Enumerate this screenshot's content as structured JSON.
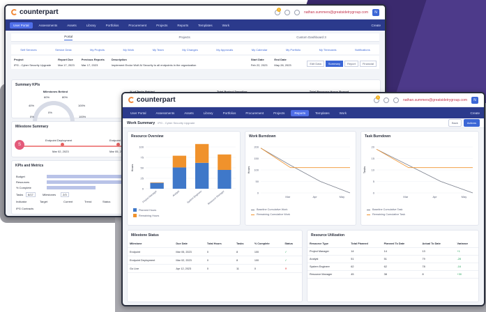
{
  "brand": "counterpart",
  "user_email": "nathan.summers@greatsidetrygroup.com",
  "avatar_initial": "N",
  "notif_count": "1",
  "nav": {
    "items": [
      "User Portal",
      "Assessments",
      "Assets",
      "Library",
      "Portfolios",
      "Procurement",
      "Projects",
      "Reports",
      "Templates",
      "Work"
    ],
    "create": "Create"
  },
  "back": {
    "tabs": [
      "Portal",
      "Projects",
      "Custom Dashboard 3"
    ],
    "subtabs": [
      "Self Services",
      "Service Desk",
      "My Projects",
      "My Work",
      "My Team",
      "My Changes",
      "My Approvals",
      "My Calendar",
      "My Portfolio",
      "My Timecards",
      "Notifications"
    ],
    "project": {
      "project_label": "Project",
      "project_val": "IPG - Cyber Security Upgrade",
      "report_due_label": "Report Due",
      "report_due_val": "Mar 17, 2023",
      "prev_label": "Previous Reports",
      "prev_val": "Mar 17, 2023",
      "desc_label": "Description",
      "desc_val": "Implement Endor Wolf AI Security to all endpoints in the organization",
      "start_label": "Start Date",
      "start_val": "Feb 22, 2023",
      "end_label": "End Date",
      "end_val": "May 28, 2023",
      "buttons": [
        "Edit Data",
        "Summary",
        "Report",
        "Financial"
      ]
    },
    "kpi": {
      "title": "Summary KPIs",
      "heads": [
        "Milestones Behind",
        "% of Tasks Behind",
        "Total Project Spending",
        "Total Resource Hours Burned"
      ],
      "gauge_ticks": [
        "60%",
        "80%",
        "40%",
        "100%",
        "0%",
        "0%",
        "100%"
      ],
      "tick_40": "40%",
      "tick_60": "60%"
    },
    "milestone_summary": {
      "title": "Milestone Summary",
      "start_glyph": "S",
      "items": [
        {
          "name": "Endpoint Deployment",
          "date": "Mar 02, 2023"
        },
        {
          "name": "Endpoint",
          "date": "Mar 05, 2023"
        }
      ]
    },
    "kpis_metrics": {
      "title": "KPIs and Metrics",
      "rows": [
        "Budget",
        "Resources",
        "% Complete"
      ],
      "tasks_label": "Tasks",
      "tasks_val": "6/17",
      "milestones_label": "Milestones",
      "milestones_val": "2/3",
      "table_heads": [
        "Indicator",
        "Target",
        "Current",
        "Trend",
        "Status"
      ],
      "table_row": "IPG Contracts"
    }
  },
  "front": {
    "title": "Work Summary",
    "subtitle": "IPG - Cyber Security Upgrade",
    "buttons": [
      "Back",
      "Actions"
    ],
    "resource_overview": {
      "title": "Resource Overview",
      "legend": [
        "Planned Hours",
        "Remaining Hours"
      ]
    },
    "work_burndown": {
      "title": "Work Burndown",
      "legend": [
        "Baseline Cumulative Work",
        "Remaining Cumulative Work"
      ]
    },
    "task_burndown": {
      "title": "Task Burndown",
      "legend": [
        "Baseline Cumulative Task",
        "Remaining Cumulative Task"
      ]
    },
    "milestone_status": {
      "title": "Milestone Status",
      "headers": [
        "Milestone",
        "Due Date",
        "Total Hours",
        "Tasks",
        "% Complete",
        "Status"
      ],
      "rows": [
        [
          "Endpoint",
          "Mar 05, 2023",
          "0",
          "8",
          "100",
          "✓"
        ],
        [
          "Endpoint Deployment",
          "Mar 02, 2023",
          "0",
          "8",
          "100",
          "✓"
        ],
        [
          "Go Live",
          "Apr 12, 2023",
          "0",
          "11",
          "0",
          "✕"
        ]
      ]
    },
    "resource_utilization": {
      "title": "Resource Utilization",
      "headers": [
        "Resource Type",
        "Total Planned",
        "Planned To Date",
        "Actual To Date",
        "Variance"
      ],
      "rows": [
        [
          "Project Manager",
          "14",
          "14",
          "13",
          "+1"
        ],
        [
          "Analyst",
          "51",
          "51",
          "79",
          "-28"
        ],
        [
          "System Engineer",
          "62",
          "62",
          "78",
          "-16"
        ],
        [
          "Resource Manager",
          "45",
          "38",
          "8",
          "+30"
        ]
      ]
    }
  },
  "chart_data": [
    {
      "type": "bar",
      "title": "Resource Overview",
      "ylabel": "Hours",
      "categories": [
        "Project Manager",
        "Analyst",
        "System Engineer",
        "Resource Manager"
      ],
      "series": [
        {
          "name": "Planned Hours",
          "values": [
            14,
            51,
            62,
            45
          ]
        },
        {
          "name": "Remaining Hours",
          "values": [
            1,
            28,
            45,
            37
          ]
        }
      ],
      "ylim": [
        0,
        100
      ],
      "yticks": [
        "0",
        "25",
        "50",
        "75",
        "100"
      ],
      "colors": [
        "#3f78c9",
        "#f0922c"
      ]
    },
    {
      "type": "line",
      "title": "Work Burndown",
      "ylabel": "Hours",
      "x": [
        "Mar",
        "Apr",
        "May"
      ],
      "ylim": [
        0,
        200
      ],
      "yticks": [
        "0",
        "50",
        "100",
        "150",
        "200"
      ],
      "series": [
        {
          "name": "Baseline Cumulative Work",
          "values": [
            195,
            120,
            50,
            0
          ]
        },
        {
          "name": "Remaining Cumulative Work",
          "values": [
            195,
            110,
            110,
            110
          ]
        }
      ],
      "colors": [
        "#7a7f8c",
        "#f0922c"
      ]
    },
    {
      "type": "line",
      "title": "Task Burndown",
      "ylabel": "Tasks",
      "x": [
        "Mar",
        "Apr",
        "May"
      ],
      "ylim": [
        0,
        20
      ],
      "yticks": [
        "0",
        "5",
        "10",
        "15",
        "20"
      ],
      "series": [
        {
          "name": "Baseline Cumulative Task",
          "values": [
            19,
            12,
            5,
            0
          ]
        },
        {
          "name": "Remaining Cumulative Task",
          "values": [
            19,
            11,
            11,
            11
          ]
        }
      ],
      "colors": [
        "#7a7f8c",
        "#f0922c"
      ]
    }
  ]
}
